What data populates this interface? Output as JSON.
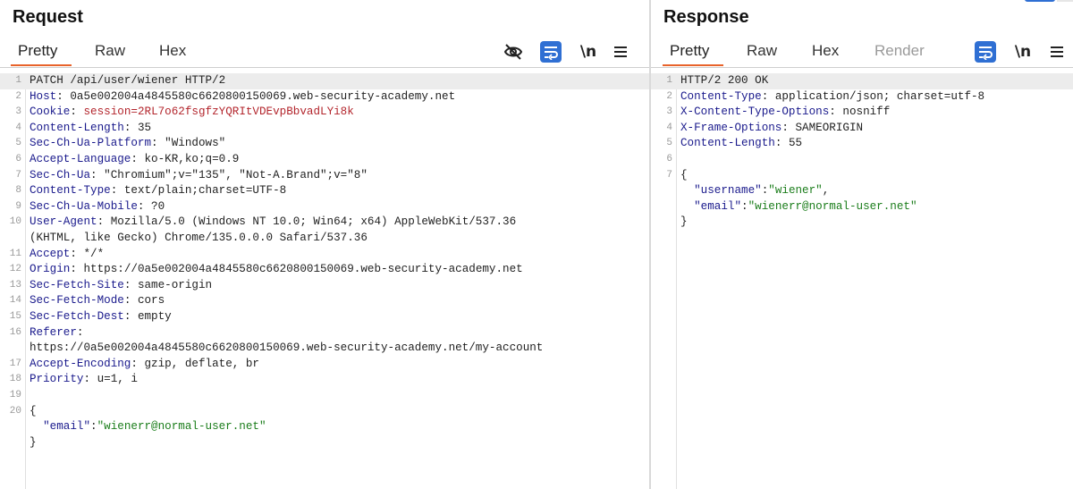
{
  "request": {
    "title": "Request",
    "tabs": [
      "Pretty",
      "Raw",
      "Hex"
    ],
    "active_tab": "Pretty",
    "icons": [
      "hide-nonprintable-icon",
      "wrap-lines-icon",
      "newline-icon",
      "menu-icon"
    ],
    "newline_label": "\\n",
    "lines": [
      {
        "n": "1",
        "t": "PATCH /api/user/wiener HTTP/2"
      },
      {
        "n": "2",
        "k": "Host",
        "v": "0a5e002004a4845580c6620800150069.web-security-academy.net"
      },
      {
        "n": "3",
        "k": "Cookie",
        "ck": "session",
        "cv": "2RL7o62fsgfzYQRItVDEvpBbvadLYi8k"
      },
      {
        "n": "4",
        "k": "Content-Length",
        "v": "35"
      },
      {
        "n": "5",
        "k": "Sec-Ch-Ua-Platform",
        "v": "\"Windows\""
      },
      {
        "n": "6",
        "k": "Accept-Language",
        "v": "ko-KR,ko;q=0.9"
      },
      {
        "n": "7",
        "k": "Sec-Ch-Ua",
        "v": "\"Chromium\";v=\"135\", \"Not-A.Brand\";v=\"8\""
      },
      {
        "n": "8",
        "k": "Content-Type",
        "v": "text/plain;charset=UTF-8"
      },
      {
        "n": "9",
        "k": "Sec-Ch-Ua-Mobile",
        "v": "?0"
      },
      {
        "n": "10",
        "k": "User-Agent",
        "v": "Mozilla/5.0 (Windows NT 10.0; Win64; x64) AppleWebKit/537.36"
      },
      {
        "n": "",
        "t": "(KHTML, like Gecko) Chrome/135.0.0.0 Safari/537.36"
      },
      {
        "n": "11",
        "k": "Accept",
        "v": "*/*"
      },
      {
        "n": "12",
        "k": "Origin",
        "v": "https://0a5e002004a4845580c6620800150069.web-security-academy.net"
      },
      {
        "n": "13",
        "k": "Sec-Fetch-Site",
        "v": "same-origin"
      },
      {
        "n": "14",
        "k": "Sec-Fetch-Mode",
        "v": "cors"
      },
      {
        "n": "15",
        "k": "Sec-Fetch-Dest",
        "v": "empty"
      },
      {
        "n": "16",
        "k": "Referer",
        "v": ""
      },
      {
        "n": "",
        "t": "https://0a5e002004a4845580c6620800150069.web-security-academy.net/my-account"
      },
      {
        "n": "17",
        "k": "Accept-Encoding",
        "v": "gzip, deflate, br"
      },
      {
        "n": "18",
        "k": "Priority",
        "v": "u=1, i"
      },
      {
        "n": "19",
        "t": ""
      },
      {
        "n": "20",
        "t": "{"
      },
      {
        "n": "",
        "jk": "\"email\"",
        "jv": "\"wienerr@normal-user.net\"",
        "indent": "  "
      },
      {
        "n": "",
        "t": "}"
      }
    ]
  },
  "response": {
    "title": "Response",
    "tabs": [
      "Pretty",
      "Raw",
      "Hex",
      "Render"
    ],
    "active_tab": "Pretty",
    "icons": [
      "wrap-lines-icon",
      "newline-icon",
      "menu-icon"
    ],
    "newline_label": "\\n",
    "lines": [
      {
        "n": "1",
        "t": "HTTP/2 200 OK"
      },
      {
        "n": "2",
        "k": "Content-Type",
        "v": "application/json; charset=utf-8"
      },
      {
        "n": "3",
        "k": "X-Content-Type-Options",
        "v": "nosniff"
      },
      {
        "n": "4",
        "k": "X-Frame-Options",
        "v": "SAMEORIGIN"
      },
      {
        "n": "5",
        "k": "Content-Length",
        "v": "55"
      },
      {
        "n": "6",
        "t": ""
      },
      {
        "n": "7",
        "t": "{"
      },
      {
        "n": "",
        "jk": "\"username\"",
        "jv": "\"wiener\"",
        "indent": "  ",
        "trail": ","
      },
      {
        "n": "",
        "jk": "\"email\"",
        "jv": "\"wienerr@normal-user.net\"",
        "indent": "  "
      },
      {
        "n": "",
        "t": "}"
      }
    ]
  },
  "colors": {
    "accent_tab_underline": "#e8632b",
    "selected_icon_bg": "#2f6fd3",
    "header_key": "#1a1a8c",
    "cookie": "#b3262d",
    "json_value": "#1b7d1b"
  }
}
